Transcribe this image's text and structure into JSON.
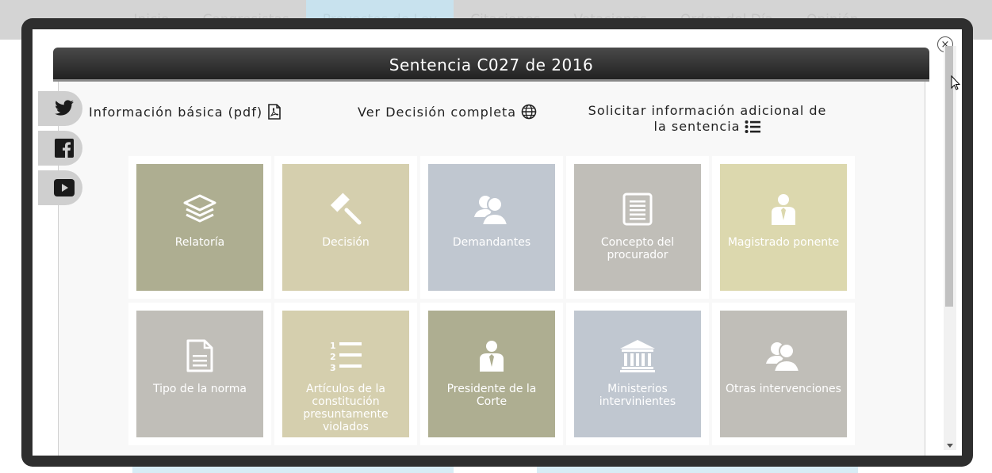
{
  "nav": {
    "items": [
      "Inicio",
      "Congresistas",
      "Proyectos de Ley",
      "Citaciones",
      "Votaciones",
      "Orden del Día",
      "Opinión"
    ],
    "active_index": 2
  },
  "modal": {
    "title": "Sentencia C027 de 2016",
    "close_symbol": "×"
  },
  "social": [
    "twitter-icon",
    "facebook-icon",
    "youtube-icon"
  ],
  "links": {
    "basic_info": "Información básica (pdf)",
    "full_decision": "Ver Decisión completa",
    "request_info_line1": "Solicitar información adicional de",
    "request_info_line2": "la sentencia"
  },
  "tiles": [
    {
      "label": "Relatoría",
      "icon": "layers-icon",
      "color": "#aeae91"
    },
    {
      "label": "Decisión",
      "icon": "gavel-icon",
      "color": "#d5cfae"
    },
    {
      "label": "Demandantes",
      "icon": "users-icon",
      "color": "#c0c7d0"
    },
    {
      "label": "Concepto del procurador",
      "icon": "document-icon",
      "color": "#c0beb8"
    },
    {
      "label": "Magistrado ponente",
      "icon": "person-icon",
      "color": "#dcd8ae"
    },
    {
      "label": "Tipo de la norma",
      "icon": "file-text-icon",
      "color": "#c0beb8"
    },
    {
      "label": "Artículos de la constitución presuntamente violados",
      "icon": "numbered-list-icon",
      "color": "#d5cfae"
    },
    {
      "label": "Presidente de la Corte",
      "icon": "person-icon",
      "color": "#aeae91"
    },
    {
      "label": "Ministerios intervinientes",
      "icon": "bank-icon",
      "color": "#c0c7d0"
    },
    {
      "label": "Otras intervenciones",
      "icon": "users-icon",
      "color": "#c0beb8"
    }
  ]
}
